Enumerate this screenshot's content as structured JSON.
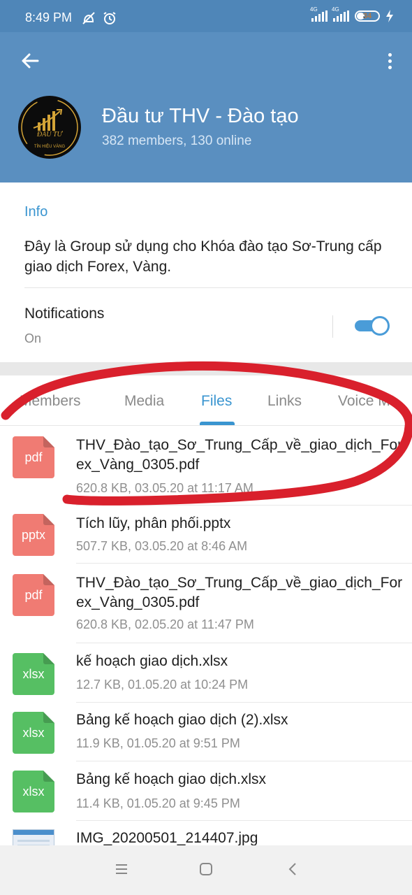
{
  "status_bar": {
    "time": "8:49 PM",
    "network_1": "4G",
    "network_2": "4G",
    "battery": "34",
    "icons": [
      "mute-icon",
      "alarm-icon",
      "signal-icon",
      "battery-icon",
      "charging-icon"
    ]
  },
  "header": {
    "title": "Đầu tư THV - Đào tạo",
    "subtitle": "382 members, 130 online",
    "avatar_line1": "ĐẦU TƯ",
    "avatar_line2": "TÍN HIỆU VÀNG",
    "colors": {
      "bar": "#5a8fc0",
      "avatar_gold": "#d4a437"
    }
  },
  "info": {
    "label": "Info",
    "description": "Đây là Group sử dụng cho Khóa đào tạo Sơ-Trung cấp giao dịch Forex, Vàng."
  },
  "notifications": {
    "label": "Notifications",
    "value": "On",
    "enabled": true
  },
  "tabs": [
    {
      "label": "Members"
    },
    {
      "label": "Media"
    },
    {
      "label": "Files"
    },
    {
      "label": "Links"
    },
    {
      "label": "Voice Ms"
    }
  ],
  "active_tab": "Files",
  "files": [
    {
      "type": "pdf",
      "name": "THV_Đào_tạo_Sơ_Trung_Cấp_về_giao_dịch_Forex_Vàng_0305.pdf",
      "meta": "620.8 KB, 03.05.20 at 11:17 AM"
    },
    {
      "type": "pptx",
      "name": "Tích lũy, phân phối.pptx",
      "meta": "507.7 KB, 03.05.20 at 8:46 AM"
    },
    {
      "type": "pdf",
      "name": "THV_Đào_tạo_Sơ_Trung_Cấp_về_giao_dịch_Forex_Vàng_0305.pdf",
      "meta": "620.8 KB, 02.05.20 at 11:47 PM"
    },
    {
      "type": "xlsx",
      "name": "kế hoạch giao dịch.xlsx",
      "meta": "12.7 KB, 01.05.20 at 10:24 PM"
    },
    {
      "type": "xlsx",
      "name": "Bảng kế hoạch giao dịch (2).xlsx",
      "meta": "11.9 KB, 01.05.20 at 9:51 PM"
    },
    {
      "type": "xlsx",
      "name": "Bảng kế hoạch giao dịch.xlsx",
      "meta": "11.4 KB, 01.05.20 at 9:45 PM"
    },
    {
      "type": "jpg",
      "name": "IMG_20200501_214407.jpg",
      "meta": ""
    }
  ],
  "colors": {
    "accent": "#3a95d0",
    "pdf": "#f07b73",
    "xlsx": "#56bf63",
    "annotation": "#d9202c"
  }
}
